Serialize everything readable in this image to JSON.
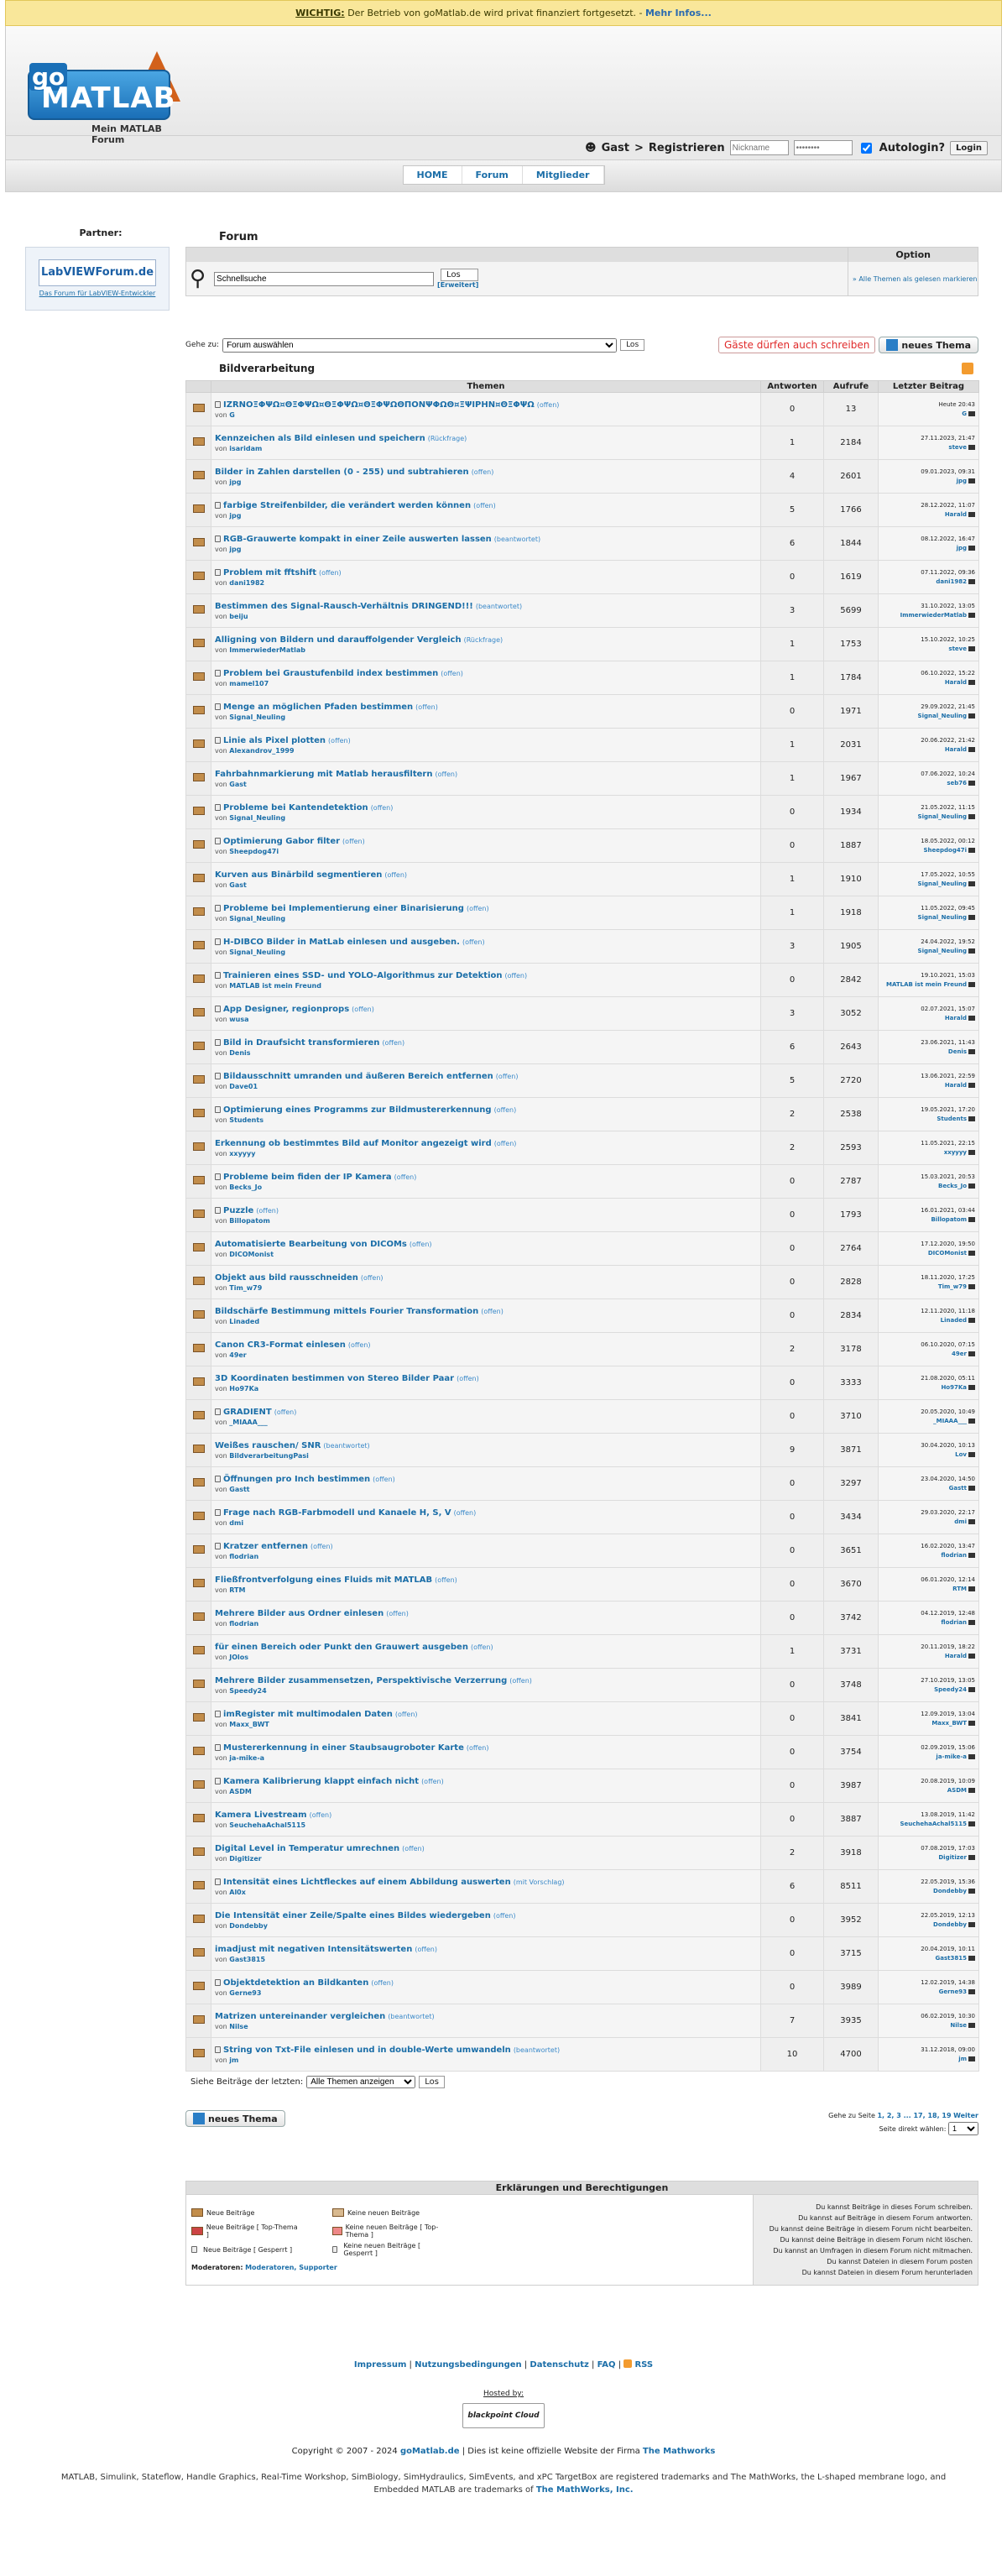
{
  "notice": {
    "label": "WICHTIG:",
    "text": " Der Betrieb von goMatlab.de wird privat finanziert fortgesetzt. - ",
    "more": "Mehr Infos..."
  },
  "logo": {
    "word": "MATLAB",
    "go": "go",
    "subtitle": "Mein MATLAB Forum"
  },
  "login": {
    "user": "Gast",
    "sep": " > ",
    "register": "Registrieren",
    "nickname_ph": "Nickname",
    "password_ph": "••••••••",
    "autologin": "Autologin?",
    "login_btn": "Login"
  },
  "nav": [
    "HOME",
    "Forum",
    "Mitglieder"
  ],
  "partner": {
    "title": "Partner:",
    "ad_name": "LabVIEWForum.de",
    "ad_tag": "Das Forum für LabVIEW-Entwickler"
  },
  "forum": {
    "title": "Forum",
    "option": "Option",
    "search_value": "Schnellsuche",
    "los": "Los",
    "erweitert": "[Erweitert]",
    "mark_read": "» Alle Themen als gelesen markieren"
  },
  "goto": {
    "label": "Gehe zu:",
    "select": "Forum auswählen",
    "los": "Los",
    "guest": "Gäste dürfen auch schreiben",
    "new_topic": "neues Thema"
  },
  "category": "Bildverarbeitung",
  "columns": [
    "Themen",
    "Antworten",
    "Aufrufe",
    "Letzter Beitrag"
  ],
  "rows": [
    {
      "title": "IZRNΟΞΦΨΩ¤ΘΞΦΨΩ¤ΘΞΦΨΩ¤ΘΞΦΨΩΘΠΟΝΨΦΩΘ¤ΞΨΙΡΗΝ¤ΘΞΦΨΩ",
      "status": "(offen)",
      "by": "G",
      "a": "0",
      "v": "13",
      "date": "Heute 20:43",
      "who": "G",
      "lock": true
    },
    {
      "title": "Kennzeichen als Bild einlesen und speichern",
      "status": "(Rückfrage)",
      "by": "isaridam",
      "a": "1",
      "v": "2184",
      "date": "27.11.2023, 21:47",
      "who": "steve",
      "lock": false
    },
    {
      "title": "Bilder in Zahlen darstellen (0 - 255) und subtrahieren",
      "status": "(offen)",
      "by": "jpg",
      "a": "4",
      "v": "2601",
      "date": "09.01.2023, 09:31",
      "who": "jpg",
      "lock": false
    },
    {
      "title": "farbige Streifenbilder, die verändert werden können",
      "status": "(offen)",
      "by": "jpg",
      "a": "5",
      "v": "1766",
      "date": "28.12.2022, 11:07",
      "who": "Harald",
      "lock": true
    },
    {
      "title": "RGB-Grauwerte kompakt in einer Zeile auswerten lassen",
      "status": "(beantwortet)",
      "by": "jpg",
      "a": "6",
      "v": "1844",
      "date": "08.12.2022, 16:47",
      "who": "jpg",
      "lock": true
    },
    {
      "title": "Problem mit fftshift",
      "status": "(offen)",
      "by": "dani1982",
      "a": "0",
      "v": "1619",
      "date": "07.11.2022, 09:36",
      "who": "dani1982",
      "lock": true
    },
    {
      "title": "Bestimmen des Signal-Rausch-Verhältnis DRINGEND!!!",
      "status": "(beantwortet)",
      "by": "beiju",
      "a": "3",
      "v": "5699",
      "date": "31.10.2022, 13:05",
      "who": "ImmerwiederMatlab",
      "lock": false
    },
    {
      "title": "Alligning von Bildern und darauffolgender Vergleich",
      "status": "(Rückfrage)",
      "by": "ImmerwiederMatlab",
      "a": "1",
      "v": "1753",
      "date": "15.10.2022, 10:25",
      "who": "steve",
      "lock": false
    },
    {
      "title": "Problem bei Graustufenbild index bestimmen",
      "status": "(offen)",
      "by": "mamel107",
      "a": "1",
      "v": "1784",
      "date": "06.10.2022, 15:22",
      "who": "Harald",
      "lock": true
    },
    {
      "title": "Menge an möglichen Pfaden bestimmen",
      "status": "(offen)",
      "by": "Signal_Neuling",
      "a": "0",
      "v": "1971",
      "date": "29.09.2022, 21:45",
      "who": "Signal_Neuling",
      "lock": true
    },
    {
      "title": "Linie als Pixel plotten",
      "status": "(offen)",
      "by": "Alexandrov_1999",
      "a": "1",
      "v": "2031",
      "date": "20.06.2022, 21:42",
      "who": "Harald",
      "lock": true
    },
    {
      "title": "Fahrbahnmarkierung mit Matlab herausfiltern",
      "status": "(offen)",
      "by": "Gast",
      "a": "1",
      "v": "1967",
      "date": "07.06.2022, 10:24",
      "who": "seb76",
      "lock": false
    },
    {
      "title": "Probleme bei Kantendetektion",
      "status": "(offen)",
      "by": "Signal_Neuling",
      "a": "0",
      "v": "1934",
      "date": "21.05.2022, 11:15",
      "who": "Signal_Neuling",
      "lock": true
    },
    {
      "title": "Optimierung Gabor filter",
      "status": "(offen)",
      "by": "Sheepdog47i",
      "a": "0",
      "v": "1887",
      "date": "18.05.2022, 00:12",
      "who": "Sheepdog47i",
      "lock": true
    },
    {
      "title": "Kurven aus Binärbild segmentieren",
      "status": "(offen)",
      "by": "Gast",
      "a": "1",
      "v": "1910",
      "date": "17.05.2022, 10:55",
      "who": "Signal_Neuling",
      "lock": false
    },
    {
      "title": "Probleme bei Implementierung einer Binarisierung",
      "status": "(offen)",
      "by": "Signal_Neuling",
      "a": "1",
      "v": "1918",
      "date": "11.05.2022, 09:45",
      "who": "Signal_Neuling",
      "lock": true
    },
    {
      "title": "H-DIBCO Bilder in MatLab einlesen und ausgeben.",
      "status": "(offen)",
      "by": "Signal_Neuling",
      "a": "3",
      "v": "1905",
      "date": "24.04.2022, 19:52",
      "who": "Signal_Neuling",
      "lock": true
    },
    {
      "title": "Trainieren eines SSD- und YOLO-Algorithmus zur Detektion",
      "status": "(offen)",
      "by": "MATLAB ist mein Freund",
      "a": "0",
      "v": "2842",
      "date": "19.10.2021, 15:03",
      "who": "MATLAB ist mein Freund",
      "lock": true
    },
    {
      "title": "App Designer, regionprops",
      "status": "(offen)",
      "by": "wusa",
      "a": "3",
      "v": "3052",
      "date": "02.07.2021, 15:07",
      "who": "Harald",
      "lock": true
    },
    {
      "title": "Bild in Draufsicht transformieren",
      "status": "(offen)",
      "by": "Denis",
      "a": "6",
      "v": "2643",
      "date": "23.06.2021, 11:43",
      "who": "Denis",
      "lock": true
    },
    {
      "title": "Bildausschnitt umranden und äußeren Bereich entfernen",
      "status": "(offen)",
      "by": "Dave01",
      "a": "5",
      "v": "2720",
      "date": "13.06.2021, 22:59",
      "who": "Harald",
      "lock": true
    },
    {
      "title": "Optimierung eines Programms zur Bildmustererkennung",
      "status": "(offen)",
      "by": "Students",
      "a": "2",
      "v": "2538",
      "date": "19.05.2021, 17:20",
      "who": "Students",
      "lock": true
    },
    {
      "title": "Erkennung ob bestimmtes Bild auf Monitor angezeigt wird",
      "status": "(offen)",
      "by": "xxyyyy",
      "a": "2",
      "v": "2593",
      "date": "11.05.2021, 22:15",
      "who": "xxyyyy",
      "lock": false
    },
    {
      "title": "Probleme beim fiden der IP Kamera",
      "status": "(offen)",
      "by": "Becks_Jo",
      "a": "0",
      "v": "2787",
      "date": "15.03.2021, 20:53",
      "who": "Becks_Jo",
      "lock": true
    },
    {
      "title": "Puzzle",
      "status": "(offen)",
      "by": "Billopatom",
      "a": "0",
      "v": "1793",
      "date": "16.01.2021, 03:44",
      "who": "Billopatom",
      "lock": true
    },
    {
      "title": "Automatisierte Bearbeitung von DICOMs",
      "status": "(offen)",
      "by": "DICOMonist",
      "a": "0",
      "v": "2764",
      "date": "17.12.2020, 19:50",
      "who": "DICOMonist",
      "lock": false
    },
    {
      "title": "Objekt aus bild rausschneiden",
      "status": "(offen)",
      "by": "Tim_w79",
      "a": "0",
      "v": "2828",
      "date": "18.11.2020, 17:25",
      "who": "Tim_w79",
      "lock": false
    },
    {
      "title": "Bildschärfe Bestimmung mittels Fourier Transformation",
      "status": "(offen)",
      "by": "Linaded",
      "a": "0",
      "v": "2834",
      "date": "12.11.2020, 11:18",
      "who": "Linaded",
      "lock": false
    },
    {
      "title": "Canon CR3-Format einlesen",
      "status": "(offen)",
      "by": "49er",
      "a": "2",
      "v": "3178",
      "date": "06.10.2020, 07:15",
      "who": "49er",
      "lock": false
    },
    {
      "title": "3D Koordinaten bestimmen von Stereo Bilder Paar",
      "status": "(offen)",
      "by": "Ho97Ka",
      "a": "0",
      "v": "3333",
      "date": "21.08.2020, 05:11",
      "who": "Ho97Ka",
      "lock": false
    },
    {
      "title": "GRADIENT",
      "status": "(offen)",
      "by": "_MIAAA___",
      "a": "0",
      "v": "3710",
      "date": "20.05.2020, 10:49",
      "who": "_MIAAA___",
      "lock": true
    },
    {
      "title": "Weißes rauschen/ SNR",
      "status": "(beantwortet)",
      "by": "BildverarbeitungPasi",
      "a": "9",
      "v": "3871",
      "date": "30.04.2020, 10:13",
      "who": "Lov",
      "lock": false
    },
    {
      "title": "Öffnungen pro Inch bestimmen",
      "status": "(offen)",
      "by": "Gastt",
      "a": "0",
      "v": "3297",
      "date": "23.04.2020, 14:50",
      "who": "Gastt",
      "lock": true
    },
    {
      "title": "Frage nach RGB-Farbmodell und Kanaele H, S, V",
      "status": "(offen)",
      "by": "dmi",
      "a": "0",
      "v": "3434",
      "date": "29.03.2020, 22:17",
      "who": "dmi",
      "lock": true
    },
    {
      "title": "Kratzer entfernen",
      "status": "(offen)",
      "by": "flodrian",
      "a": "0",
      "v": "3651",
      "date": "16.02.2020, 13:47",
      "who": "flodrian",
      "lock": true
    },
    {
      "title": "Fließfrontverfolgung eines Fluids mit MATLAB",
      "status": "(offen)",
      "by": "RTM",
      "a": "0",
      "v": "3670",
      "date": "06.01.2020, 12:14",
      "who": "RTM",
      "lock": false
    },
    {
      "title": "Mehrere Bilder aus Ordner einlesen",
      "status": "(offen)",
      "by": "flodrian",
      "a": "0",
      "v": "3742",
      "date": "04.12.2019, 12:48",
      "who": "flodrian",
      "lock": false
    },
    {
      "title": "für einen Bereich oder Punkt den Grauwert ausgeben",
      "status": "(offen)",
      "by": "JOlos",
      "a": "1",
      "v": "3731",
      "date": "20.11.2019, 18:22",
      "who": "Harald",
      "lock": false
    },
    {
      "title": "Mehrere Bilder zusammensetzen, Perspektivische Verzerrung",
      "status": "(offen)",
      "by": "Speedy24",
      "a": "0",
      "v": "3748",
      "date": "27.10.2019, 13:05",
      "who": "Speedy24",
      "lock": false
    },
    {
      "title": "imRegister mit multimodalen Daten",
      "status": "(offen)",
      "by": "Maxx_BWT",
      "a": "0",
      "v": "3841",
      "date": "12.09.2019, 13:04",
      "who": "Maxx_BWT",
      "lock": true
    },
    {
      "title": "Mustererkennung in einer Staubsaugroboter Karte",
      "status": "(offen)",
      "by": "ja-mike-a",
      "a": "0",
      "v": "3754",
      "date": "02.09.2019, 15:06",
      "who": "ja-mike-a",
      "lock": true
    },
    {
      "title": "Kamera Kalibrierung klappt einfach nicht",
      "status": "(offen)",
      "by": "ASDM",
      "a": "0",
      "v": "3987",
      "date": "20.08.2019, 10:09",
      "who": "ASDM",
      "lock": true
    },
    {
      "title": "Kamera Livestream",
      "status": "(offen)",
      "by": "SeuchehaAchal5115",
      "a": "0",
      "v": "3887",
      "date": "13.08.2019, 11:42",
      "who": "SeuchehaAchal5115",
      "lock": false
    },
    {
      "title": "Digital Level in Temperatur umrechnen",
      "status": "(offen)",
      "by": "Digitizer",
      "a": "2",
      "v": "3918",
      "date": "07.08.2019, 17:03",
      "who": "Digitizer",
      "lock": false
    },
    {
      "title": "Intensität eines Lichtfleckes auf einem Abbildung auswerten",
      "status": "(mit Vorschlag)",
      "by": "Al0x",
      "a": "6",
      "v": "8511",
      "date": "22.05.2019, 15:36",
      "who": "Dondebby",
      "lock": true
    },
    {
      "title": "Die Intensität einer Zeile/Spalte eines Bildes wiedergeben",
      "status": "(offen)",
      "by": "Dondebby",
      "a": "0",
      "v": "3952",
      "date": "22.05.2019, 12:13",
      "who": "Dondebby",
      "lock": false
    },
    {
      "title": "imadjust mit negativen Intensitätswerten",
      "status": "(offen)",
      "by": "Gast3815",
      "a": "0",
      "v": "3715",
      "date": "20.04.2019, 10:11",
      "who": "Gast3815",
      "lock": false
    },
    {
      "title": "Objektdetektion an Bildkanten",
      "status": "(offen)",
      "by": "Gerne93",
      "a": "0",
      "v": "3989",
      "date": "12.02.2019, 14:38",
      "who": "Gerne93",
      "lock": true
    },
    {
      "title": "Matrizen untereinander vergleichen",
      "status": "(beantwortet)",
      "by": "Nilse",
      "a": "7",
      "v": "3935",
      "date": "06.02.2019, 10:30",
      "who": "Nilse",
      "lock": false
    },
    {
      "title": "String von Txt-File einlesen und in double-Werte umwandeln",
      "status": "(beantwortet)",
      "by": "jm",
      "a": "10",
      "v": "4700",
      "date": "31.12.2018, 09:00",
      "who": "jm",
      "lock": true
    }
  ],
  "by_prefix": "von ",
  "after": {
    "label": "Siehe Beiträge der letzten:",
    "select": "Alle Themen anzeigen",
    "los": "Los"
  },
  "pager": {
    "goto": "Gehe zu Seite ",
    "pages": "1, 2, 3 ... 17, 18, 19",
    "next": "Weiter",
    "choose": "Seite direkt wählen:",
    "current": "1"
  },
  "legend": {
    "title": "Erklärungen und Berechtigungen",
    "items": [
      "Neue Beiträge",
      "Keine neuen Beiträge",
      "Neue Beiträge [ Top-Thema ]",
      "Keine neuen Beiträge [ Top-Thema ]",
      "Neue Beiträge [ Gesperrt ]",
      "Keine neuen Beiträge [ Gesperrt ]"
    ],
    "mods_label": "Moderatoren:",
    "mods": "Moderatoren, Supporter",
    "perms": [
      "Du kannst Beiträge in dieses Forum schreiben.",
      "Du kannst auf Beiträge in diesem Forum antworten.",
      "Du kannst deine Beiträge in diesem Forum nicht bearbeiten.",
      "Du kannst deine Beiträge in diesem Forum nicht löschen.",
      "Du kannst an Umfragen in diesem Forum nicht mitmachen.",
      "Du kannst Dateien in diesem Forum posten",
      "Du kannst Dateien in diesem Forum herunterladen"
    ]
  },
  "footer": {
    "links": [
      "Impressum",
      "Nutzungsbedingungen",
      "Datenschutz",
      "FAQ",
      "RSS"
    ],
    "hosted": "Hosted by:",
    "host": "blackpoint Cloud",
    "copy1": "Copyright © 2007 - 2024 ",
    "copy_site": "goMatlab.de",
    "copy2": " | Dies ist keine offizielle Website der Firma ",
    "copy_co": "The Mathworks",
    "tm1": "MATLAB, Simulink, Stateflow, Handle Graphics, Real-Time Workshop, SimBiology, SimHydraulics, SimEvents, and xPC TargetBox are registered trademarks and The MathWorks, the L-shaped membrane logo, and Embedded MATLAB are trademarks of ",
    "tm_co": "The MathWorks, Inc."
  }
}
